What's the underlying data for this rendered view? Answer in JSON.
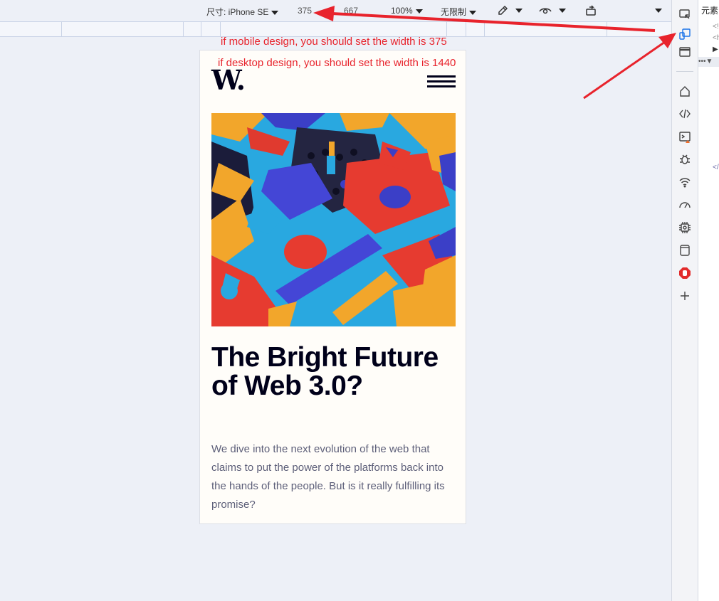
{
  "devtools_toolbar": {
    "dimensions_label": "尺寸: iPhone SE",
    "width": "375",
    "times": "×",
    "height": "667",
    "zoom": "100%",
    "throttle": "无限制"
  },
  "devtools_panel": {
    "elements_tab": "元素"
  },
  "annotations": {
    "mobile_note": "if mobile design, you should set the width is 375",
    "desktop_note": "if desktop design, you should set the width is 1440",
    "color": "#e8232c"
  },
  "page": {
    "logo": "W.",
    "headline": "The Bright Future of Web 3.0?",
    "description": "We dive into the next evolution of the web that claims to put the power of the platforms back into the hands of the people. But is it really fulfilling its promise?",
    "colors": {
      "background": "#fffdf9",
      "text_dark": "#00001a",
      "text_body": "#5d5f79"
    }
  },
  "icons": {
    "hero": "colorful-3d-blocks-image",
    "menu": "hamburger-menu-icon"
  }
}
